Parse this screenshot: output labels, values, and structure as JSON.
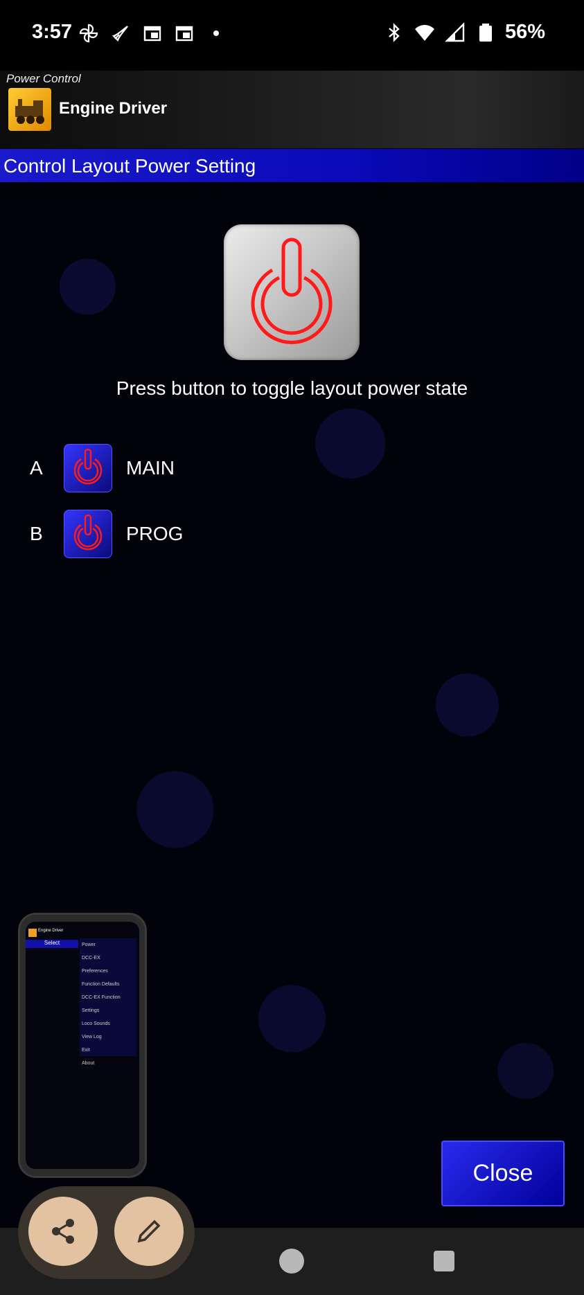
{
  "status_bar": {
    "time": "3:57",
    "left_icons": [
      "pinwheel-icon",
      "rocket-icon",
      "calendar-icon",
      "calendar-icon",
      "dot-icon"
    ],
    "right_icons": [
      "bluetooth-icon",
      "wifi-icon",
      "signal-icon",
      "battery-icon"
    ],
    "battery": "56%"
  },
  "app_bar": {
    "subtitle": "Power Control",
    "title": "Engine Driver"
  },
  "section": {
    "title": "Control Layout Power Setting"
  },
  "main": {
    "hint": "Press button to toggle layout power state",
    "tracks": [
      {
        "letter": "A",
        "label": "MAIN"
      },
      {
        "letter": "B",
        "label": "PROG"
      }
    ],
    "close_label": "Close"
  },
  "thumbnail": {
    "header_title": "Engine Driver",
    "select": "Select",
    "menu_items": [
      "Power",
      "DCC-EX",
      "Preferences",
      "Function Defaults",
      "DCC-EX Function Settings",
      "Loco Sounds",
      "View Log",
      "Exit",
      "About"
    ]
  },
  "colors": {
    "accent_blue": "#0a0ab8",
    "power_red": "#ff1a1a",
    "fab_bg": "#e2c2a0"
  }
}
